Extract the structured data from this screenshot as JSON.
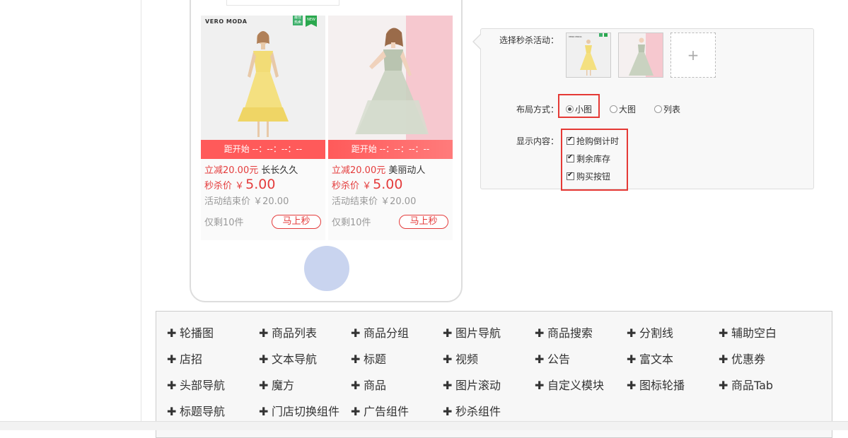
{
  "preview": {
    "cards": [
      {
        "brand": "VERO MODA",
        "badge1": "最佳热卖",
        "badge2": "NEW",
        "countdown": "距开始 --：--：--：--",
        "discount": "立减20.00元",
        "title": "长长久久",
        "price_label": "秒杀价",
        "price_symbol": "￥",
        "price": "5.00",
        "end_price": "活动结束价 ￥20.00",
        "stock": "仅剩10件",
        "buy": "马上秒"
      },
      {
        "countdown": "距开始 --：--：--：--",
        "discount": "立减20.00元",
        "title": "美丽动人",
        "price_label": "秒杀价",
        "price_symbol": "￥",
        "price": "5.00",
        "end_price": "活动结束价 ￥20.00",
        "stock": "仅剩10件",
        "buy": "马上秒"
      }
    ]
  },
  "settings": {
    "activity_label": "选择秒杀活动：",
    "thumb_brand": "VERO MODA",
    "add_symbol": "+",
    "layout_label": "布局方式：",
    "layout_options": [
      "小图",
      "大图",
      "列表"
    ],
    "layout_selected": "小图",
    "display_label": "显示内容：",
    "display_options": [
      "抢购倒计时",
      "剩余库存",
      "购买按钮"
    ]
  },
  "components": {
    "rows": [
      [
        "轮播图",
        "商品列表",
        "商品分组",
        "图片导航",
        "商品搜索",
        "分割线",
        "辅助空白"
      ],
      [
        "店招",
        "文本导航",
        "标题",
        "视频",
        "公告",
        "富文本",
        "优惠券"
      ],
      [
        "头部导航",
        "魔方",
        "商品",
        "图片滚动",
        "自定义模块",
        "图标轮播",
        "商品Tab"
      ],
      [
        "标题导航",
        "门店切换组件",
        "广告组件",
        "秒杀组件"
      ]
    ]
  },
  "colors": {
    "accent_red": "#e43c3c",
    "highlight_red": "#e53935",
    "home_button": "#c9d4ef"
  }
}
